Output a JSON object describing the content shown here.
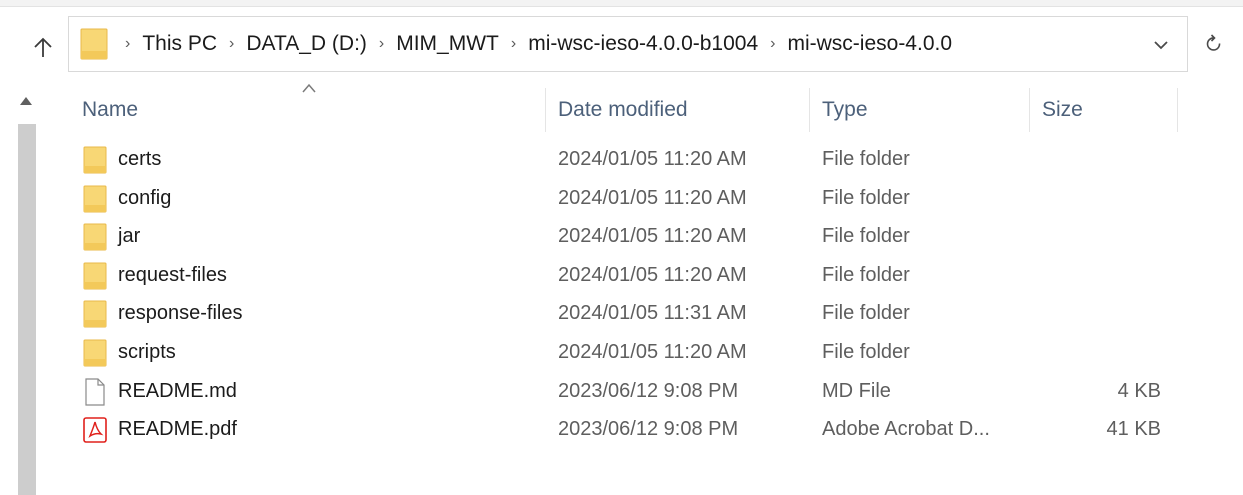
{
  "navigation": {
    "up_icon": "arrow-up-icon",
    "refresh_icon": "refresh-icon",
    "dropdown_icon": "chevron-down-icon"
  },
  "address_bar": {
    "folder_icon": "folder-icon",
    "separator": "›",
    "breadcrumbs": [
      {
        "label": "This PC"
      },
      {
        "label": "DATA_D (D:)"
      },
      {
        "label": "MIM_MWT"
      },
      {
        "label": "mi-wsc-ieso-4.0.0-b1004"
      },
      {
        "label": "mi-wsc-ieso-4.0.0"
      }
    ]
  },
  "columns": {
    "name": "Name",
    "date_modified": "Date modified",
    "type": "Type",
    "size": "Size",
    "sort": "name-descending-indicator"
  },
  "files": [
    {
      "name": "certs",
      "date": "2024/01/05 11:20 AM",
      "type": "File folder",
      "size": "",
      "icon": "folder-icon"
    },
    {
      "name": "config",
      "date": "2024/01/05 11:20 AM",
      "type": "File folder",
      "size": "",
      "icon": "folder-icon"
    },
    {
      "name": "jar",
      "date": "2024/01/05 11:20 AM",
      "type": "File folder",
      "size": "",
      "icon": "folder-icon"
    },
    {
      "name": "request-files",
      "date": "2024/01/05 11:20 AM",
      "type": "File folder",
      "size": "",
      "icon": "folder-icon"
    },
    {
      "name": "response-files",
      "date": "2024/01/05 11:31 AM",
      "type": "File folder",
      "size": "",
      "icon": "folder-icon"
    },
    {
      "name": "scripts",
      "date": "2024/01/05 11:20 AM",
      "type": "File folder",
      "size": "",
      "icon": "folder-icon"
    },
    {
      "name": "README.md",
      "date": "2023/06/12 9:08 PM",
      "type": "MD File",
      "size": "4 KB",
      "icon": "document-icon"
    },
    {
      "name": "README.pdf",
      "date": "2023/06/12 9:08 PM",
      "type": "Adobe Acrobat D...",
      "size": "41 KB",
      "icon": "pdf-icon"
    }
  ],
  "colors": {
    "folder": "#f8d775",
    "folder_dark": "#e8b84a",
    "pdf_red": "#e0201b",
    "header_text": "#4c607a",
    "scroll_thumb": "#cdcdcd"
  }
}
